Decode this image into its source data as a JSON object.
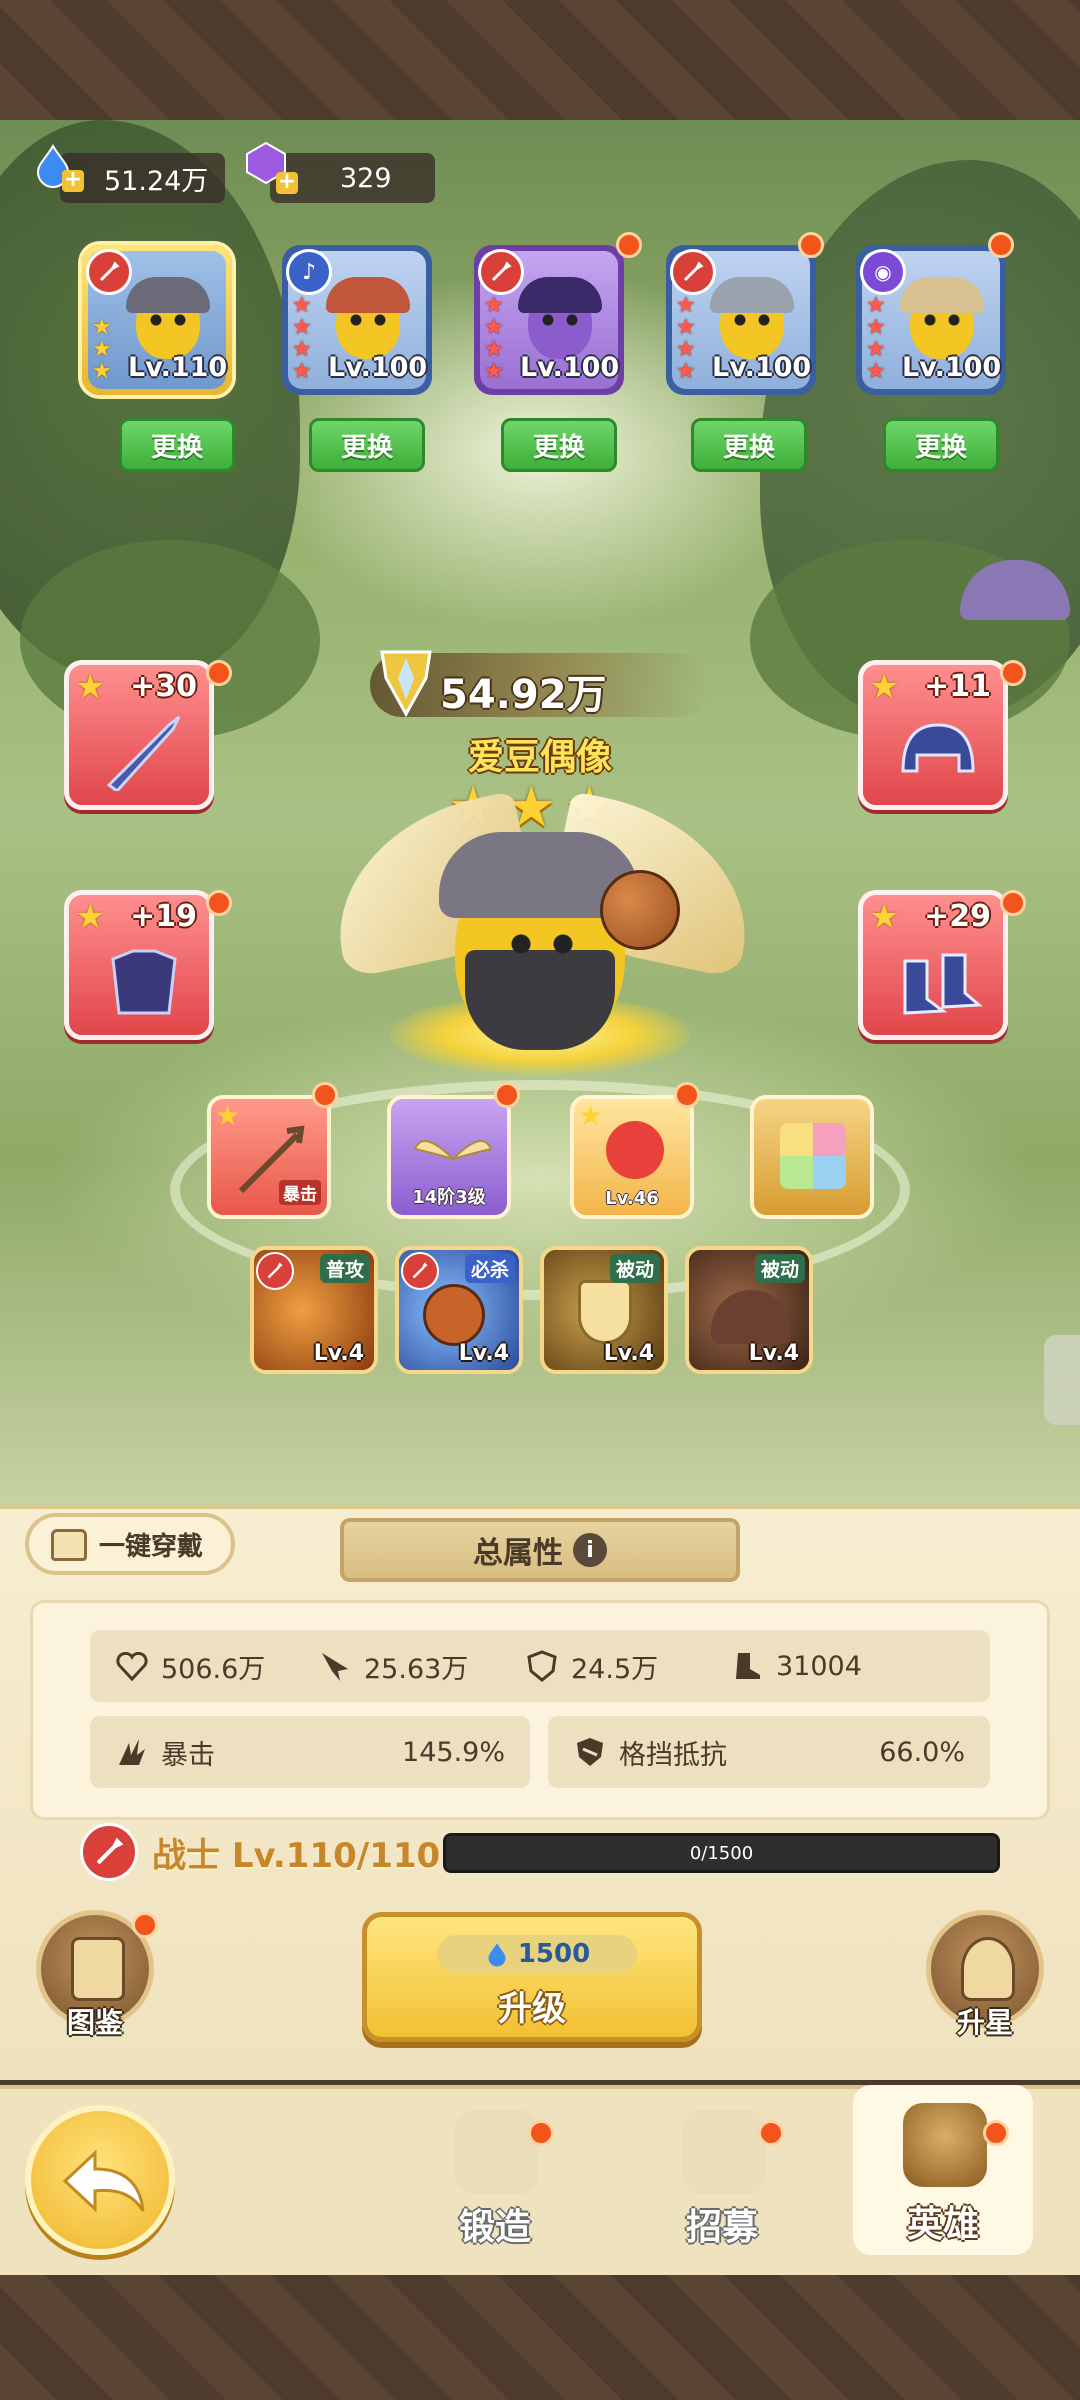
{
  "currency": {
    "water": "51.24万",
    "gem": "329"
  },
  "team": [
    {
      "level": "Lv.110",
      "class": "warrior",
      "stars": 3,
      "selected": true
    },
    {
      "level": "Lv.100",
      "class": "music",
      "stars": 5
    },
    {
      "level": "Lv.100",
      "class": "warrior",
      "stars": 5
    },
    {
      "level": "Lv.100",
      "class": "warrior",
      "stars": 5
    },
    {
      "level": "Lv.100",
      "class": "mage",
      "stars": 5
    }
  ],
  "swap_label": "更换",
  "hero": {
    "power": "54.92万",
    "name": "爱豆偶像",
    "stars": 3
  },
  "equipment": {
    "weapon": "+30",
    "helmet": "+11",
    "armor": "+19",
    "boots": "+29"
  },
  "special_skills": [
    {
      "label": "暴击"
    },
    {
      "label": "14阶3级"
    },
    {
      "label": "Lv.46"
    },
    {
      "label": ""
    }
  ],
  "skills": [
    {
      "tag": "普攻",
      "level": "Lv.4"
    },
    {
      "tag": "必杀",
      "level": "Lv.4"
    },
    {
      "tag": "被动",
      "level": "Lv.4"
    },
    {
      "tag": "被动",
      "level": "Lv.4"
    }
  ],
  "one_key_equip": "一键穿戴",
  "total_attr_label": "总属性",
  "stats": {
    "hp": "506.6万",
    "attack": "25.63万",
    "defense": "24.5万",
    "speed": "31004",
    "crit_label": "暴击",
    "crit_value": "145.9%",
    "block_label": "格挡抵抗",
    "block_value": "66.0%"
  },
  "class_line": "战士 Lv.110/110",
  "exp": "0/1500",
  "codex_label": "图鉴",
  "star_up_label": "升星",
  "upgrade": {
    "cost": "1500",
    "label": "升级"
  },
  "nav": {
    "forge": "锻造",
    "recruit": "招募",
    "hero": "英雄"
  },
  "colors": {
    "accent_gold": "#f2c032",
    "notify_red": "#f2541b",
    "swap_green": "#3fae3a",
    "equip_red": "#e0464a"
  }
}
